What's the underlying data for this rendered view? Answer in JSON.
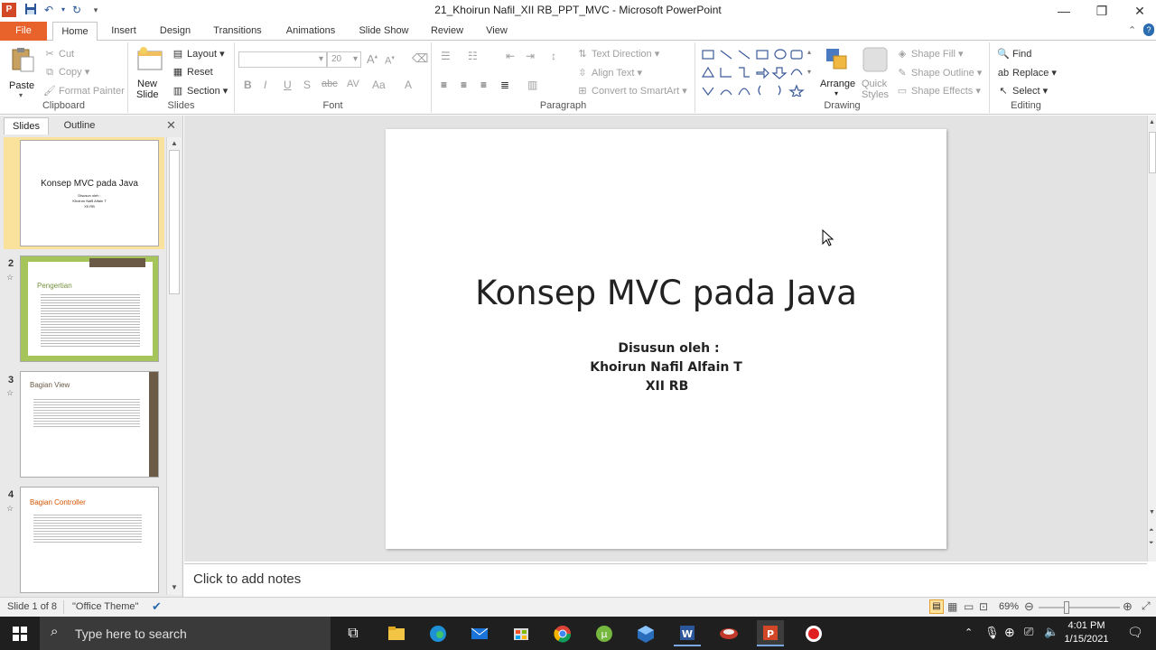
{
  "window": {
    "title": "21_Khoirun Nafil_XII RB_PPT_MVC  -  Microsoft PowerPoint"
  },
  "tabs": [
    "File",
    "Home",
    "Insert",
    "Design",
    "Transitions",
    "Animations",
    "Slide Show",
    "Review",
    "View"
  ],
  "ribbon": {
    "clipboard": {
      "paste": "Paste",
      "cut": "Cut",
      "copy": "Copy",
      "format_painter": "Format Painter",
      "label": "Clipboard"
    },
    "slides": {
      "new_slide": "New",
      "new_slide_2": "Slide",
      "layout": "Layout",
      "reset": "Reset",
      "section": "Section",
      "label": "Slides"
    },
    "font": {
      "size": "20",
      "label": "Font"
    },
    "paragraph": {
      "text_direction": "Text Direction",
      "align_text": "Align Text",
      "convert_smartart": "Convert to SmartArt",
      "label": "Paragraph"
    },
    "drawing": {
      "arrange": "Arrange",
      "quick_styles": "Quick",
      "quick_styles_2": "Styles",
      "shape_fill": "Shape Fill",
      "shape_outline": "Shape Outline",
      "shape_effects": "Shape Effects",
      "label": "Drawing"
    },
    "editing": {
      "find": "Find",
      "replace": "Replace",
      "select": "Select",
      "label": "Editing"
    }
  },
  "panel": {
    "tab_slides": "Slides",
    "tab_outline": "Outline",
    "slides": [
      {
        "num": "1",
        "title": "Konsep MVC pada Java",
        "sub1": "Disusun oleh :",
        "sub2": "Khoirun Nafil Alfain T",
        "sub3": "XII RB"
      },
      {
        "num": "2",
        "title": "Pengertian"
      },
      {
        "num": "3",
        "title": "Bagian View"
      },
      {
        "num": "4",
        "title": "Bagian Controller"
      }
    ]
  },
  "slide": {
    "title": "Konsep MVC pada Java",
    "line1": "Disusun oleh :",
    "line2": "Khoirun Nafil Alfain T",
    "line3": "XII RB"
  },
  "notes": {
    "placeholder": "Click to add notes"
  },
  "status": {
    "slide_of": "Slide 1 of 8",
    "theme": "\"Office Theme\"",
    "zoom": "69%"
  },
  "taskbar": {
    "search_placeholder": "Type here to search",
    "time": "4:01 PM",
    "date": "1/15/2021"
  },
  "colors": {
    "file_tab": "#e8622c",
    "slide2_green": "#9bbb59",
    "slide3_brown": "#6b5a45",
    "slide4_orange": "#d35400"
  }
}
